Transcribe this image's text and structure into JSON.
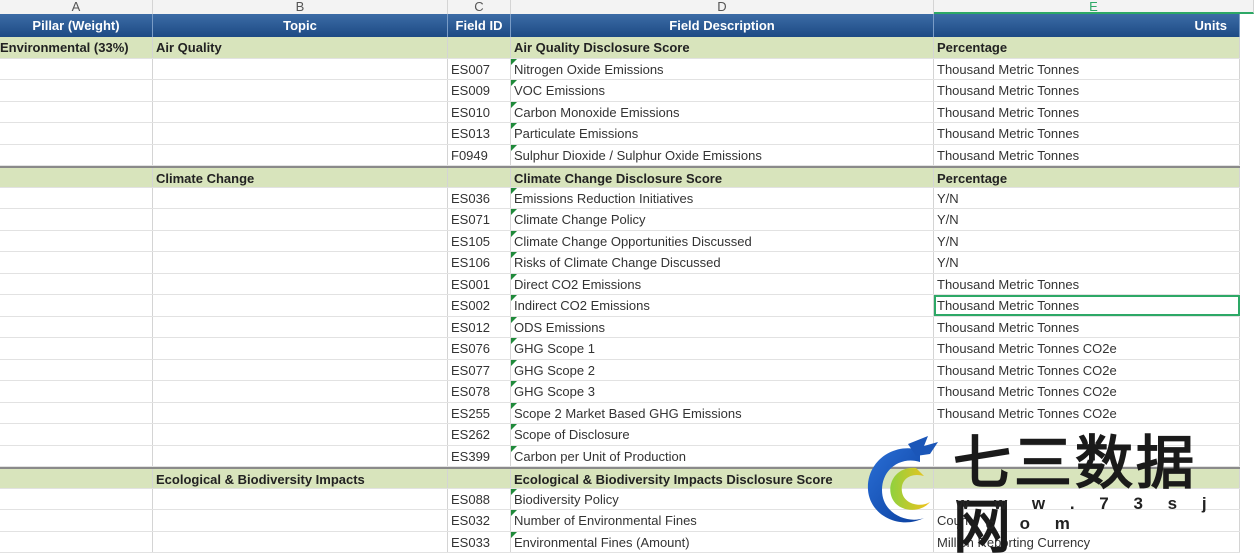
{
  "column_letters": [
    "A",
    "B",
    "C",
    "D",
    "E"
  ],
  "header": {
    "pillar": "Pillar (Weight)",
    "topic": "Topic",
    "field_id": "Field ID",
    "field_description": "Field Description",
    "units": "Units"
  },
  "rows": [
    {
      "type": "group",
      "pillar": "Environmental (33%)",
      "topic": "Air Quality",
      "field_id": "",
      "description": "Air Quality Disclosure Score",
      "units": "Percentage"
    },
    {
      "type": "item",
      "field_id": "ES007",
      "description": "Nitrogen Oxide Emissions",
      "units": "Thousand Metric Tonnes"
    },
    {
      "type": "item",
      "field_id": "ES009",
      "description": "VOC Emissions",
      "units": "Thousand Metric Tonnes"
    },
    {
      "type": "item",
      "field_id": "ES010",
      "description": "Carbon Monoxide Emissions",
      "units": "Thousand Metric Tonnes"
    },
    {
      "type": "item",
      "field_id": "ES013",
      "description": "Particulate Emissions",
      "units": "Thousand Metric Tonnes"
    },
    {
      "type": "item",
      "field_id": "F0949",
      "description": "Sulphur Dioxide / Sulphur Oxide Emissions",
      "units": "Thousand Metric Tonnes"
    },
    {
      "type": "group",
      "pillar": "",
      "topic": "Climate Change",
      "field_id": "",
      "description": "Climate Change Disclosure Score",
      "units": "Percentage"
    },
    {
      "type": "item",
      "field_id": "ES036",
      "description": "Emissions Reduction Initiatives",
      "units": "Y/N"
    },
    {
      "type": "item",
      "field_id": "ES071",
      "description": "Climate Change Policy",
      "units": "Y/N"
    },
    {
      "type": "item",
      "field_id": "ES105",
      "description": "Climate Change Opportunities Discussed",
      "units": "Y/N"
    },
    {
      "type": "item",
      "field_id": "ES106",
      "description": "Risks of Climate Change Discussed",
      "units": "Y/N"
    },
    {
      "type": "item",
      "field_id": "ES001",
      "description": "Direct CO2 Emissions",
      "units": "Thousand Metric Tonnes"
    },
    {
      "type": "item",
      "field_id": "ES002",
      "description": "Indirect CO2 Emissions",
      "units": "Thousand Metric Tonnes"
    },
    {
      "type": "item",
      "field_id": "ES012",
      "description": "ODS Emissions",
      "units": "Thousand Metric Tonnes"
    },
    {
      "type": "item",
      "field_id": "ES076",
      "description": "GHG Scope 1",
      "units": "Thousand Metric Tonnes CO2e"
    },
    {
      "type": "item",
      "field_id": "ES077",
      "description": "GHG Scope 2",
      "units": "Thousand Metric Tonnes CO2e"
    },
    {
      "type": "item",
      "field_id": "ES078",
      "description": "GHG Scope 3",
      "units": "Thousand Metric Tonnes CO2e"
    },
    {
      "type": "item",
      "field_id": "ES255",
      "description": "Scope 2 Market Based GHG Emissions",
      "units": "Thousand Metric Tonnes CO2e"
    },
    {
      "type": "item",
      "field_id": "ES262",
      "description": "Scope of Disclosure",
      "units": ""
    },
    {
      "type": "item",
      "field_id": "ES399",
      "description": "Carbon per Unit of Production",
      "units": ""
    },
    {
      "type": "group",
      "pillar": "",
      "topic": "Ecological & Biodiversity Impacts",
      "field_id": "",
      "description": "Ecological & Biodiversity Impacts Disclosure Score",
      "units": ""
    },
    {
      "type": "item",
      "field_id": "ES088",
      "description": "Biodiversity Policy",
      "units": ""
    },
    {
      "type": "item",
      "field_id": "ES032",
      "description": "Number of Environmental Fines",
      "units": "Count"
    },
    {
      "type": "item",
      "field_id": "ES033",
      "description": "Environmental Fines (Amount)",
      "units": "Million Reporting Currency"
    }
  ],
  "selected_row_index": 12,
  "watermark": {
    "brand": "七三数据网",
    "url": "w w w . 7 3 s j . c o m"
  },
  "colors": {
    "header_bg": "#1d4a84",
    "group_bg": "#d8e4bc",
    "selection": "#2da866"
  }
}
